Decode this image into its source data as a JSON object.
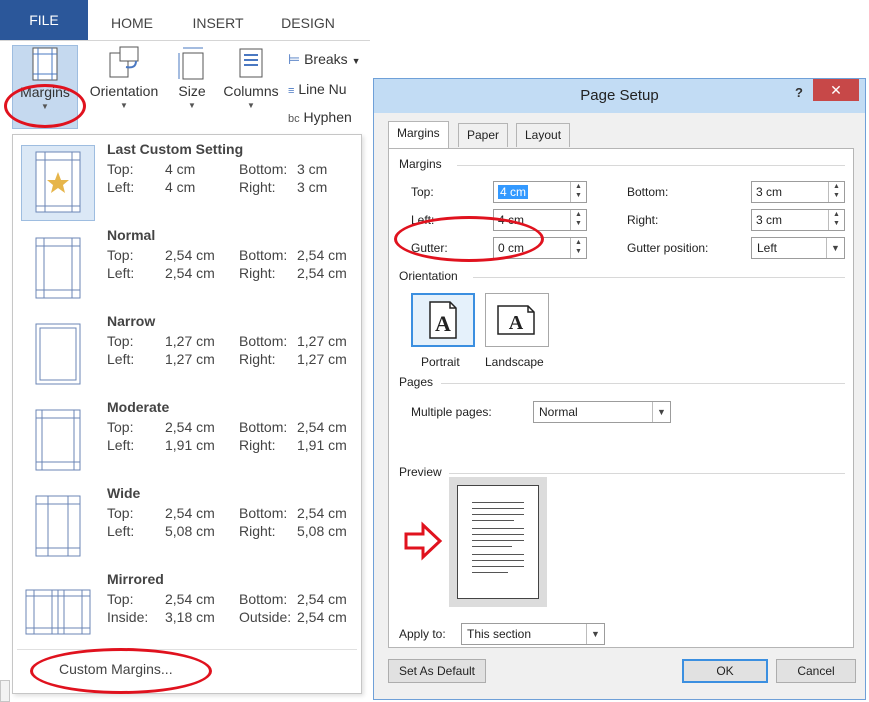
{
  "ribbon": {
    "tabs": [
      "FILE",
      "HOME",
      "INSERT",
      "DESIGN"
    ],
    "buttons": {
      "margins": "Margins",
      "orientation": "Orientation",
      "size": "Size",
      "columns": "Columns"
    },
    "small": {
      "breaks": "Breaks",
      "line_numbers": "Line Nu",
      "hyphenation": "Hyphen"
    }
  },
  "margins_menu": {
    "items": [
      {
        "title": "Last Custom Setting",
        "top": "4 cm",
        "bottom": "3 cm",
        "left": "4 cm",
        "right": "3 cm"
      },
      {
        "title": "Normal",
        "top": "2,54 cm",
        "bottom": "2,54 cm",
        "left": "2,54 cm",
        "right": "2,54 cm"
      },
      {
        "title": "Narrow",
        "top": "1,27 cm",
        "bottom": "1,27 cm",
        "left": "1,27 cm",
        "right": "1,27 cm"
      },
      {
        "title": "Moderate",
        "top": "2,54 cm",
        "bottom": "2,54 cm",
        "left": "1,91 cm",
        "right": "1,91 cm"
      },
      {
        "title": "Wide",
        "top": "2,54 cm",
        "bottom": "2,54 cm",
        "left": "5,08 cm",
        "right": "5,08 cm"
      },
      {
        "title": "Mirrored",
        "top": "2,54 cm",
        "bottom": "2,54 cm",
        "left": "3,18 cm",
        "right": "2,54 cm"
      }
    ],
    "labels": {
      "top": "Top:",
      "bottom": "Bottom:",
      "left": "Left:",
      "right": "Right:",
      "inside": "Inside:",
      "outside": "Outside:"
    },
    "custom_margins": "Custom Margins..."
  },
  "dialog": {
    "title": "Page Setup",
    "help": "?",
    "close": "✕",
    "tabs": [
      "Margins",
      "Paper",
      "Layout"
    ],
    "margins_group": "Margins",
    "top_label": "Top:",
    "top_value": "4 cm",
    "bottom_label": "Bottom:",
    "bottom_value": "3 cm",
    "left_label": "Left:",
    "left_value": "4 cm",
    "right_label": "Right:",
    "right_value": "3 cm",
    "gutter_label": "Gutter:",
    "gutter_value": "0 cm",
    "gutter_position_label": "Gutter position:",
    "gutter_position_value": "Left",
    "orientation_group": "Orientation",
    "portrait": "Portrait",
    "landscape": "Landscape",
    "pages_group": "Pages",
    "multiple_pages_label": "Multiple pages:",
    "multiple_pages_value": "Normal",
    "preview_group": "Preview",
    "apply_to_label": "Apply to:",
    "apply_to_value": "This section",
    "set_default": "Set As Default",
    "ok": "OK",
    "cancel": "Cancel"
  },
  "colors": {
    "file_tab": "#2b579a",
    "annotation": "#e0121e",
    "dialog_title": "#c2dcf4",
    "close_button": "#c74848"
  }
}
